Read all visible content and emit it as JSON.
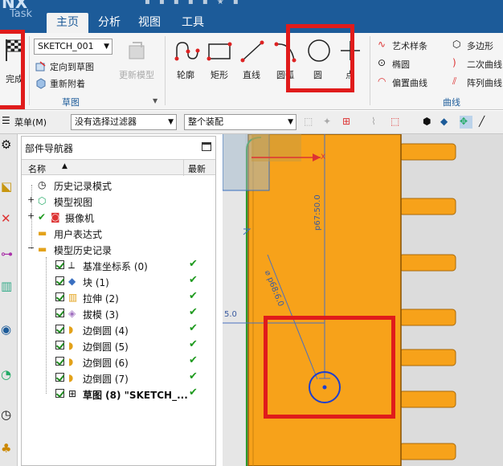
{
  "app": {
    "logo": "NX",
    "task_tab": "Task"
  },
  "tabs": [
    "主页",
    "分析",
    "视图",
    "工具"
  ],
  "ribbon": {
    "finish": "完成",
    "sketch_name": "SKETCH_001",
    "orient_to_sketch": "定向到草图",
    "reattach": "重新附着",
    "update_model": "更新模型",
    "sketch_group": "草图",
    "tools": [
      "轮廓",
      "矩形",
      "直线",
      "圆弧",
      "圆",
      "点"
    ],
    "curves": [
      [
        "艺术样条",
        "多边形"
      ],
      [
        "椭圆",
        "二次曲线"
      ],
      [
        "偏置曲线",
        "阵列曲线"
      ]
    ],
    "curve_group": "曲线"
  },
  "toolbar": {
    "menu": "菜单(M)",
    "filter": "没有选择过滤器",
    "assembly": "整个装配"
  },
  "navigator": {
    "title": "部件导航器",
    "col_name": "名称",
    "col_latest": "最新",
    "rows": [
      "历史记录模式",
      "模型视图",
      "摄像机",
      "用户表达式",
      "模型历史记录",
      "基准坐标系 (0)",
      "块 (1)",
      "拉伸 (2)",
      "拔模 (3)",
      "边倒圆 (4)",
      "边倒圆 (5)",
      "边倒圆 (6)",
      "边倒圆 (7)",
      "草图 (8) \"SKETCH_..."
    ]
  },
  "viewport": {
    "dim_vertical": "p67:50.0",
    "dim_diameter": "⌀ p68:6.0",
    "dim_left": "5.0",
    "axis_label": "X"
  },
  "colors": {
    "accent": "#1c5b99",
    "part": "#f7a21a",
    "highlight": "#e01b1b",
    "check": "#1f9a1f"
  }
}
